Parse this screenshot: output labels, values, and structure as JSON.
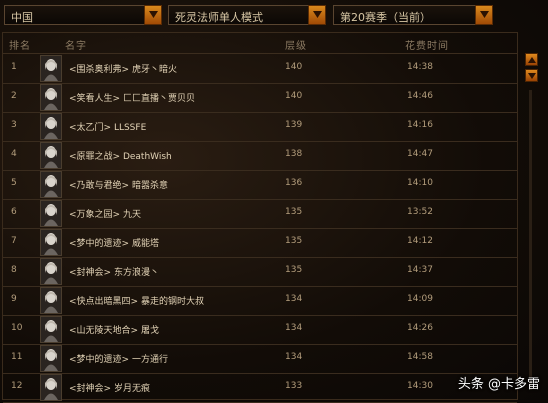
{
  "filters": {
    "region": "中国",
    "mode": "死灵法师单人模式",
    "season": "第20赛季（当前）"
  },
  "columns": {
    "rank": "排名",
    "name": "名字",
    "level": "层级",
    "time": "花费时间"
  },
  "rows": [
    {
      "rank": "1",
      "name": "<围杀奥利弗> 虎牙丶暗火",
      "level": "140",
      "time": "14:38"
    },
    {
      "rank": "2",
      "name": "<笑看人生> 匚匚直播丶贾贝贝",
      "level": "140",
      "time": "14:46"
    },
    {
      "rank": "3",
      "name": "<太乙门> LLSSFE",
      "level": "139",
      "time": "14:16"
    },
    {
      "rank": "4",
      "name": "<原罪之战> DeathWish",
      "level": "138",
      "time": "14:47"
    },
    {
      "rank": "5",
      "name": "<乃敢与君绝> 暗嚣杀意",
      "level": "136",
      "time": "14:10"
    },
    {
      "rank": "6",
      "name": "<万象之园> 九天",
      "level": "135",
      "time": "13:52"
    },
    {
      "rank": "7",
      "name": "<梦中的遗迹> 威能塔",
      "level": "135",
      "time": "14:12"
    },
    {
      "rank": "8",
      "name": "<封神会> 东方浪漫丶",
      "level": "135",
      "time": "14:37"
    },
    {
      "rank": "9",
      "name": "<快点出暗黑四> 暴走的钢时大叔",
      "level": "134",
      "time": "14:09"
    },
    {
      "rank": "10",
      "name": "<山无陵天地合> 屠戈",
      "level": "134",
      "time": "14:26"
    },
    {
      "rank": "11",
      "name": "<梦中的遗迹> 一方通行",
      "level": "134",
      "time": "14:58"
    },
    {
      "rank": "12",
      "name": "<封神会> 岁月无痕",
      "level": "133",
      "time": "14:30"
    }
  ],
  "watermark": "头条 @卡多雷",
  "icons": {
    "dropdown": "chevron-down-icon",
    "scroll_up": "arrow-up-icon",
    "scroll_down": "arrow-down-icon",
    "portrait": "necromancer-portrait-icon"
  },
  "colors": {
    "accent": "#d9891d",
    "background": "#0d0906",
    "text": "#e2d3b6"
  }
}
